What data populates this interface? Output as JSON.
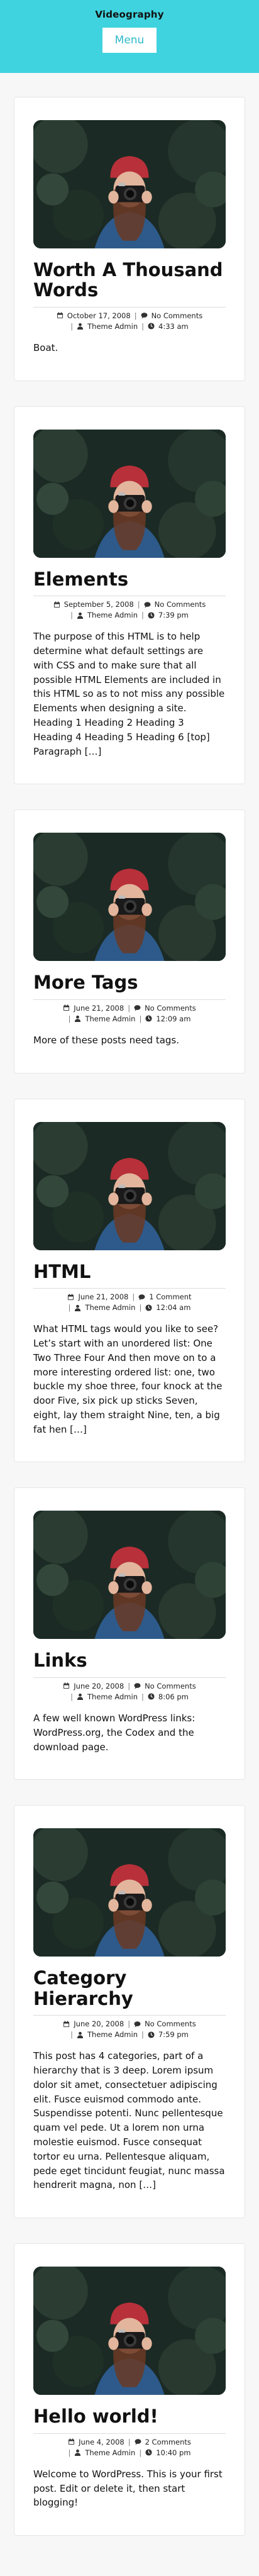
{
  "header": {
    "site_title": "Videography",
    "menu_label": "Menu",
    "background": "#3fd3df"
  },
  "posts": [
    {
      "title": "Worth A Thousand Words",
      "date": "October 17, 2008",
      "comments": "No Comments",
      "author": "Theme Admin",
      "time": "4:33 am",
      "excerpt": "Boat."
    },
    {
      "title": "Elements",
      "date": "September 5, 2008",
      "comments": "No Comments",
      "author": "Theme Admin",
      "time": "7:39 pm",
      "excerpt": "The purpose of this HTML is to help determine what default settings are with CSS and to make sure that all possible HTML Elements are included in this HTML so as to not miss any possible Elements when designing a site. Heading 1 Heading 2 Heading 3 Heading 4 Heading 5 Heading 6 [top] Paragraph […]"
    },
    {
      "title": "More Tags",
      "date": "June 21, 2008",
      "comments": "No Comments",
      "author": "Theme Admin",
      "time": "12:09 am",
      "excerpt": "More of these posts need tags."
    },
    {
      "title": "HTML",
      "date": "June 21, 2008",
      "comments": "1 Comment",
      "author": "Theme Admin",
      "time": "12:04 am",
      "excerpt": "What HTML tags would you like to see? Let’s start with an unordered list: One Two Three Four And then move on to a more interesting ordered list: one, two buckle my shoe three, four knock at the door Five, six pick up sticks Seven, eight, lay them straight Nine, ten, a big fat hen […]"
    },
    {
      "title": "Links",
      "date": "June 20, 2008",
      "comments": "No Comments",
      "author": "Theme Admin",
      "time": "8:06 pm",
      "excerpt": "A few well known WordPress links: WordPress.org, the Codex and the download page."
    },
    {
      "title": "Category Hierarchy",
      "date": "June 20, 2008",
      "comments": "No Comments",
      "author": "Theme Admin",
      "time": "7:59 pm",
      "excerpt": "This post has 4 categories, part of a hierarchy that is 3 deep. Lorem ipsum dolor sit amet, consectetuer adipiscing elit. Fusce euismod commodo ante. Suspendisse potenti. Nunc pellentesque quam vel pede. Ut a lorem non urna molestie euismod. Fusce consequat tortor eu urna. Pellentesque aliquam, pede eget tincidunt feugiat, nunc massa hendrerit magna, non […]"
    },
    {
      "title": "Hello world!",
      "date": "June 4, 2008",
      "comments": "2 Comments",
      "author": "Theme Admin",
      "time": "10:40 pm",
      "excerpt": "Welcome to WordPress. This is your first post. Edit or delete it, then start blogging!"
    }
  ],
  "icons": {
    "date": "calendar-icon",
    "comments": "comment-icon",
    "author": "user-icon",
    "time": "clock-icon"
  }
}
